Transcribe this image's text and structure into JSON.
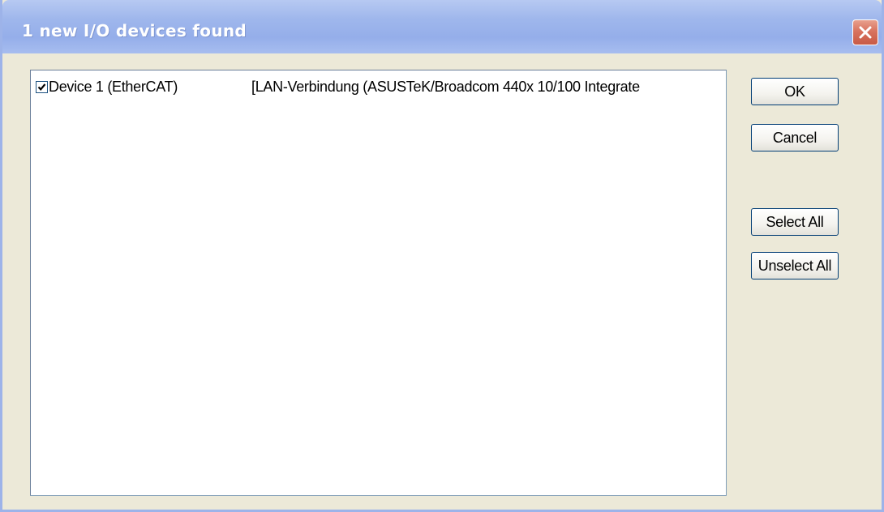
{
  "window": {
    "title": "1 new I/O devices found",
    "close_icon": "close-icon"
  },
  "devices": [
    {
      "checked": true,
      "name": "Device 1 (EtherCAT)",
      "adapter": "[LAN-Verbindung (ASUSTeK/Broadcom 440x 10/100 Integrate"
    }
  ],
  "buttons": {
    "ok": "OK",
    "cancel": "Cancel",
    "select_all": "Select All",
    "unselect_all": "Unselect All"
  },
  "colors": {
    "title_bar": "#9fb7ec",
    "close_button": "#d8735f",
    "dialog_background": "#ece9d8",
    "list_background": "#ffffff"
  }
}
